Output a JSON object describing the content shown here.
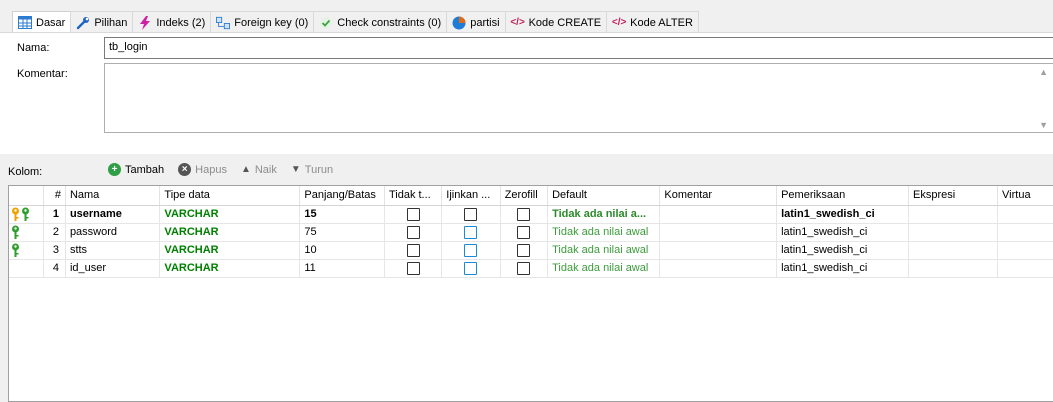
{
  "tabs": [
    {
      "label": "Dasar",
      "icon": "table-grid-icon",
      "active": true
    },
    {
      "label": "Pilihan",
      "icon": "wrench-icon"
    },
    {
      "label": "Indeks (2)",
      "icon": "lightning-icon"
    },
    {
      "label": "Foreign key (0)",
      "icon": "foreign-key-icon"
    },
    {
      "label": "Check constraints (0)",
      "icon": "check-icon"
    },
    {
      "label": "partisi",
      "icon": "pie-icon"
    },
    {
      "label": "Kode CREATE",
      "icon": "code-icon"
    },
    {
      "label": "Kode ALTER",
      "icon": "code-icon"
    }
  ],
  "form": {
    "nama_label": "Nama:",
    "nama_value": "tb_login",
    "komentar_label": "Komentar:",
    "komentar_value": ""
  },
  "kolom_label": "Kolom:",
  "toolbar": {
    "tambah": "Tambah",
    "hapus": "Hapus",
    "naik": "Naik",
    "turun": "Turun"
  },
  "columns_header": {
    "hash": "#",
    "nama": "Nama",
    "tipe": "Tipe data",
    "panjang": "Panjang/Batas",
    "tidak": "Tidak t...",
    "ijinkan": "Ijinkan ...",
    "zerofill": "Zerofill",
    "default": "Default",
    "komentar": "Komentar",
    "pemeriksaan": "Pemeriksaan",
    "ekspresi": "Ekspresi",
    "virtual": "Virtua"
  },
  "rows": [
    {
      "n": "1",
      "name": "username",
      "type": "VARCHAR",
      "len": "15",
      "default": "Tidak ada nilai a...",
      "collation": "latin1_swedish_ci"
    },
    {
      "n": "2",
      "name": "password",
      "type": "VARCHAR",
      "len": "75",
      "default": "Tidak ada nilai awal",
      "collation": "latin1_swedish_ci"
    },
    {
      "n": "3",
      "name": "stts",
      "type": "VARCHAR",
      "len": "10",
      "default": "Tidak ada nilai awal",
      "collation": "latin1_swedish_ci"
    },
    {
      "n": "4",
      "name": "id_user",
      "type": "VARCHAR",
      "len": "11",
      "default": "Tidak ada nilai awal",
      "collation": "latin1_swedish_ci"
    }
  ],
  "colors": {
    "type_green": "#008000",
    "default_green": "#3d9c3d",
    "primary_key": "#f0a000",
    "unique_key": "#2e9e2e"
  }
}
